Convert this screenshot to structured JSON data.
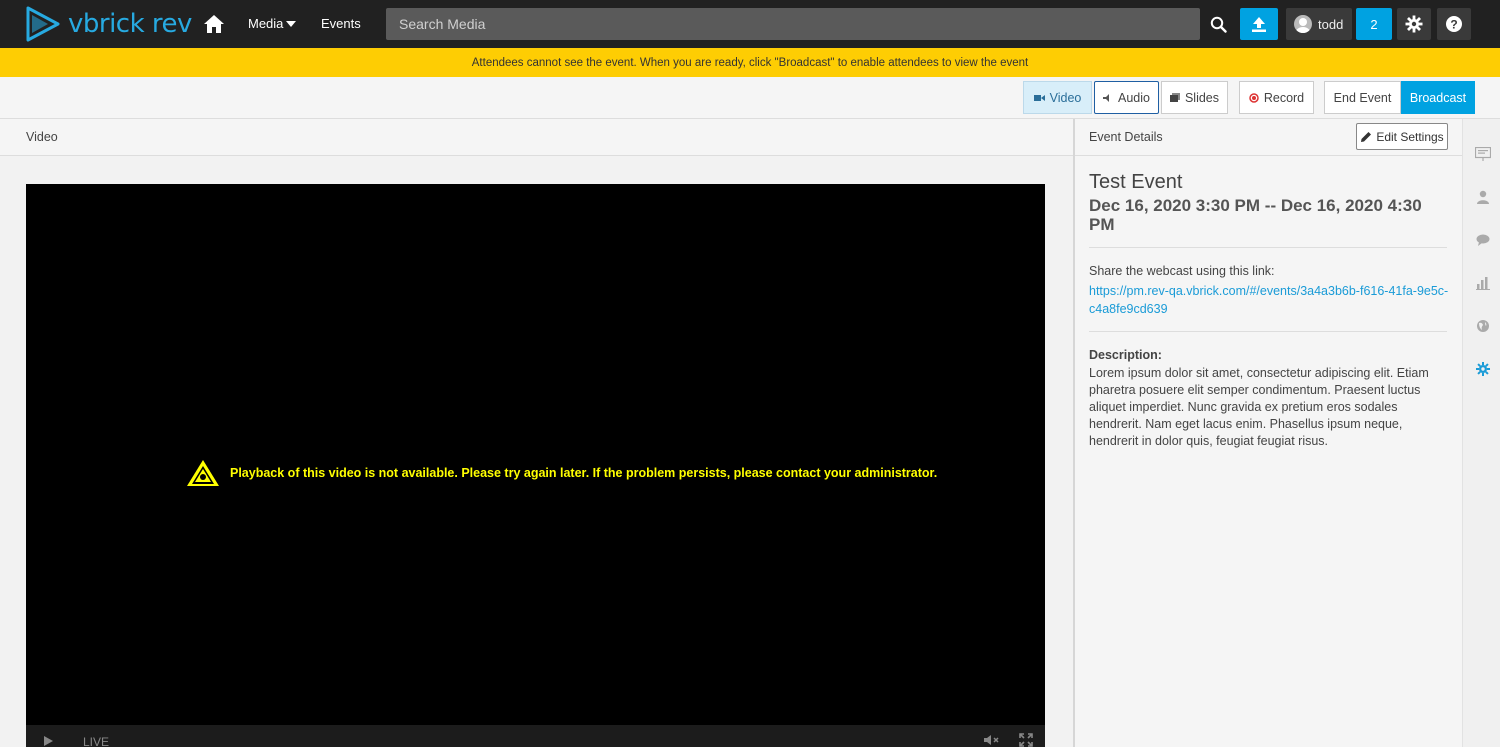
{
  "nav": {
    "logo_text": "vbrick rev",
    "media_label": "Media",
    "events_label": "Events",
    "search_placeholder": "Search Media",
    "user_name": "todd",
    "notification_count": "2"
  },
  "banner": {
    "text": "Attendees cannot see the event. When you are ready, click \"Broadcast\" to enable attendees to view the event"
  },
  "toolbar": {
    "video_label": "Video",
    "audio_label": "Audio",
    "slides_label": "Slides",
    "record_label": "Record",
    "end_event_label": "End Event",
    "broadcast_label": "Broadcast"
  },
  "video": {
    "section_title": "Video",
    "error_message": "Playback of this video is not available. Please try again later. If the problem persists, please contact your administrator.",
    "live_label": "LIVE"
  },
  "details": {
    "section_title": "Event Details",
    "edit_label": "Edit Settings",
    "event_name": "Test Event",
    "event_dates": "Dec 16, 2020 3:30 PM -- Dec 16, 2020 4:30 PM",
    "share_label": "Share the webcast using this link:",
    "share_link": "https://pm.rev-qa.vbrick.com/#/events/3a4a3b6b-f616-41fa-9e5c-c4a8fe9cd639",
    "description_label": "Description:",
    "description_text": "Lorem ipsum dolor sit amet, consectetur adipiscing elit. Etiam pharetra posuere elit semper condimentum. Praesent luctus aliquet imperdiet. Nunc gravida ex pretium eros sodales hendrerit. Nam eget lacus enim. Phasellus ipsum neque, hendrerit in dolor quis, feugiat feugiat risus."
  },
  "colors": {
    "accent": "#00a2e1",
    "banner": "#fecd03",
    "nav_bg": "#212121",
    "warning_text": "#ffff00"
  },
  "side_icons": [
    "presentation-icon",
    "user-icon",
    "chat-icon",
    "bar-chart-icon",
    "globe-icon",
    "gear-icon"
  ]
}
